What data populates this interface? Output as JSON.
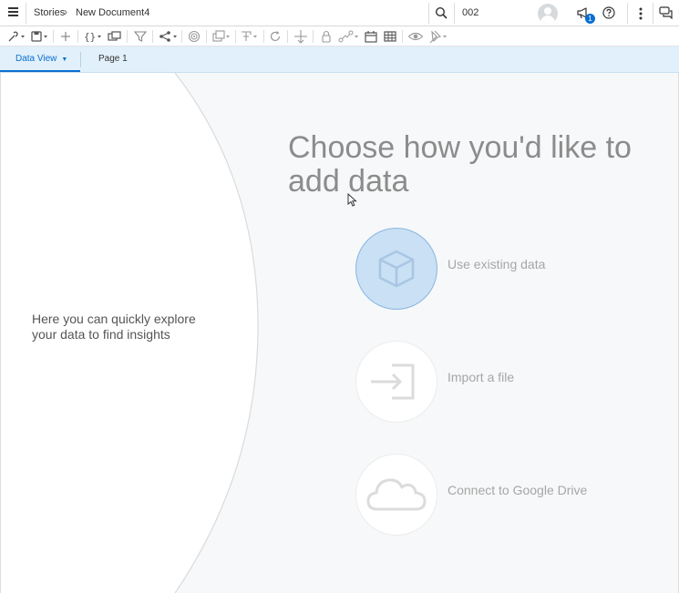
{
  "header": {
    "breadcrumb_root": "Stories",
    "breadcrumb_separator": "›",
    "document_title": "New Document4",
    "search_value": "002",
    "notification_count": "1"
  },
  "tabs": [
    {
      "label": "Data View",
      "active": true
    },
    {
      "label": "Page 1",
      "active": false
    }
  ],
  "main": {
    "hint_text": "Here you can quickly explore your data to find insights",
    "title": "Choose how you'd like to add data",
    "options": [
      {
        "label": "Use existing data",
        "icon": "cube-icon",
        "selected": true
      },
      {
        "label": "Import a file",
        "icon": "import-icon",
        "selected": false
      },
      {
        "label": "Connect to Google Drive",
        "icon": "cloud-icon",
        "selected": false
      }
    ]
  },
  "colors": {
    "accent": "#0a6ed1",
    "tab_bar": "#e1f0fb",
    "selected_circle": "#c9e0f5",
    "canvas": "#f7f8f9"
  }
}
